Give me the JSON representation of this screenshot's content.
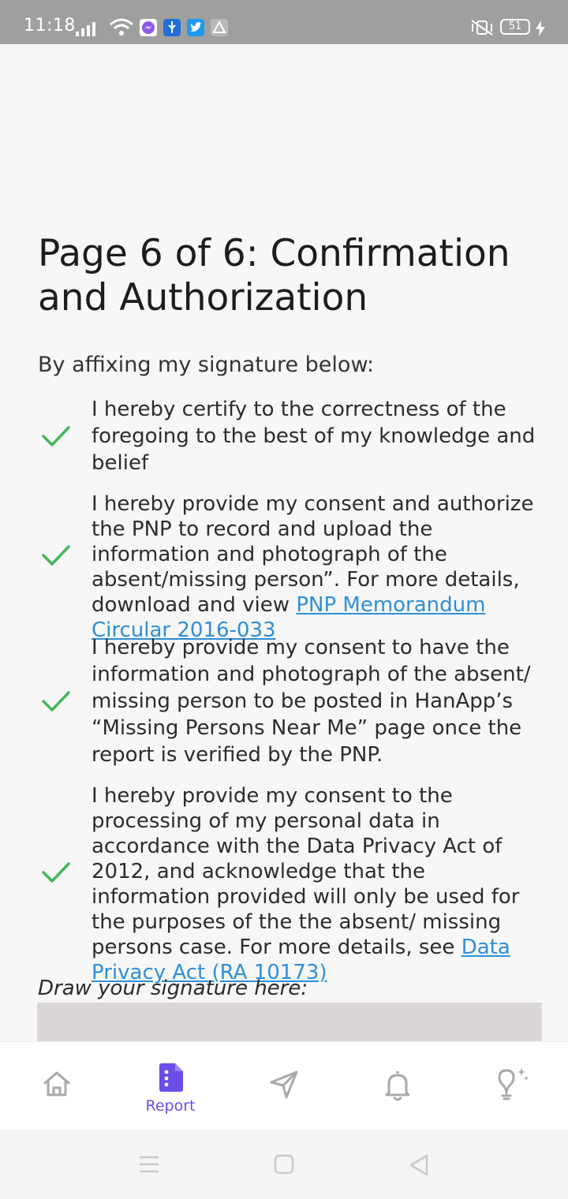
{
  "status_bar": {
    "time": "11:18",
    "battery": "51",
    "icons": [
      "signal-icon",
      "wifi-icon",
      "messenger-icon",
      "usb-icon",
      "twitter-icon",
      "app-icon",
      "vibrate-icon",
      "battery-icon",
      "charging-icon"
    ]
  },
  "page": {
    "title": "Page 6 of 6: Confirmation and Authorization",
    "intro": "By affixing my signature below:",
    "items": [
      {
        "text": "I hereby certify to the correctness of the foregoing to the best of my knowledge and belief",
        "link": ""
      },
      {
        "text": "I hereby provide my consent and authorize the PNP to record and upload the information and photograph of the absent/missing person”. For more details, download and view ",
        "link": "PNP Memorandum Circular 2016-033"
      },
      {
        "text": "I hereby provide my consent to have the information and photograph of the absent/ missing person to be posted in HanApp’s “Missing Persons Near Me” page once the report is verified by the PNP.",
        "link": ""
      },
      {
        "text": "I hereby provide my consent to the processing of my personal data in accordance with the Data Privacy Act of 2012, and acknowledge that the information provided will only be used for the purposes of the the absent/ missing persons case. For more details, see ",
        "link": "Data Privacy Act (RA 10173)"
      }
    ],
    "signature_label": "Draw your signature here:"
  },
  "bottom_nav": {
    "items": [
      {
        "icon": "home-icon",
        "label": ""
      },
      {
        "icon": "report-icon",
        "label": "Report"
      },
      {
        "icon": "send-icon",
        "label": ""
      },
      {
        "icon": "bell-icon",
        "label": ""
      },
      {
        "icon": "lightbulb-icon",
        "label": ""
      }
    ],
    "active": "Report"
  },
  "colors": {
    "accent": "#6b4de8",
    "check": "#43b85a",
    "link": "#2e8fd8",
    "signature_pad": "#dcd7d7",
    "status_bar": "#9f9f9f"
  }
}
